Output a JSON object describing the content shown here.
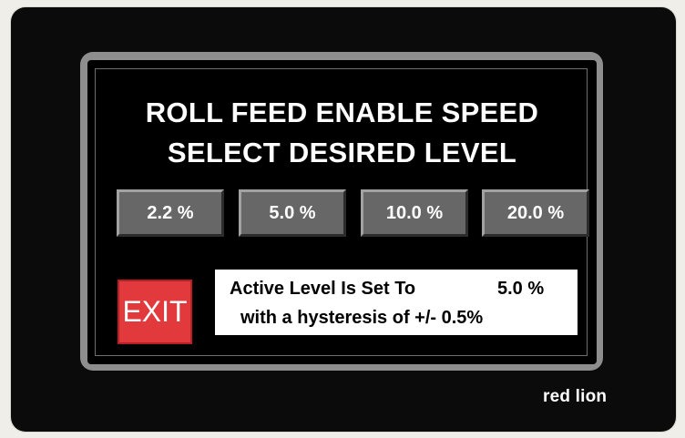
{
  "panel": {
    "title_line1": "ROLL FEED ENABLE SPEED",
    "title_line2": "SELECT DESIRED LEVEL"
  },
  "level_buttons": [
    {
      "label": "2.2 %"
    },
    {
      "label": "5.0 %"
    },
    {
      "label": "10.0 %"
    },
    {
      "label": "20.0 %"
    }
  ],
  "exit_button": {
    "label": "EXIT"
  },
  "status": {
    "active_label": "Active Level Is Set To",
    "active_value": "5.0 %",
    "hysteresis_text": "with a hysteresis of +/- 0.5%"
  },
  "brand": {
    "logo_text": "red lion"
  },
  "colors": {
    "exit_red": "#e2393d",
    "button_gray": "#676767",
    "bezel_gray": "#8e8e8e",
    "device_black": "#0b0b0b"
  }
}
